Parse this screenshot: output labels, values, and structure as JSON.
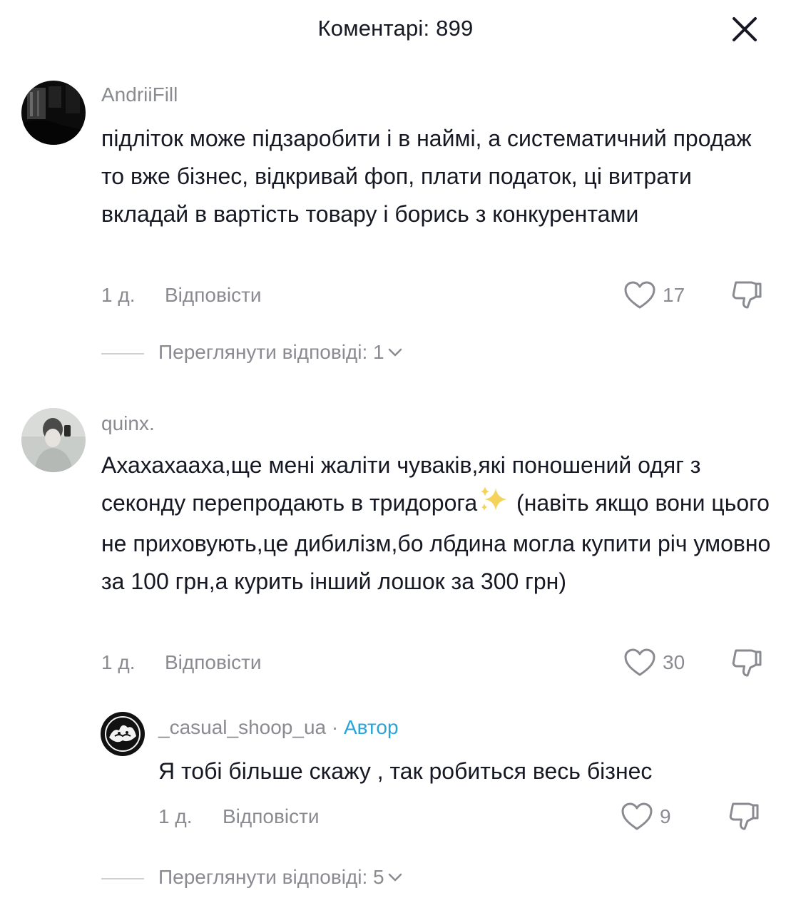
{
  "header": {
    "title": "Коментарі: 899",
    "close_icon": "close-icon"
  },
  "comments": [
    {
      "username": "AndriiFill",
      "text": "підліток може підзаробити і в наймі, а систематичний продаж то вже бізнес, відкривай фоп, плати податок, ці витрати вкладай в вартість товару і борись з конкурентами",
      "time": "1 д.",
      "reply_label": "Відповісти",
      "likes": "17",
      "view_replies": "Переглянути відповіді: 1"
    },
    {
      "username": "quinx.",
      "text_before_emoji": "Ахахахааха,ще мені жаліти чуваків,які поношений одяг з секонду перепродають в тридорога",
      "emoji": "sparkles-icon",
      "text_after_emoji": " (навіть якщо вони цього не приховують,це дибилізм,бо лбдина могла купити річ умовно за 100 грн,а курить інший лошок за 300 грн)",
      "time": "1 д.",
      "reply_label": "Відповісти",
      "likes": "30",
      "reply": {
        "username": "_casual_shoop_ua",
        "separator": "·",
        "badge": "Автор",
        "text": "Я тобі більше скажу , так робиться весь бізнес",
        "time": "1 д.",
        "reply_label": "Відповісти",
        "likes": "9"
      },
      "view_replies": "Переглянути відповіді: 5"
    }
  ],
  "colors": {
    "text": "#161823",
    "muted": "#8a8b91",
    "author": "#2aa4d8"
  }
}
